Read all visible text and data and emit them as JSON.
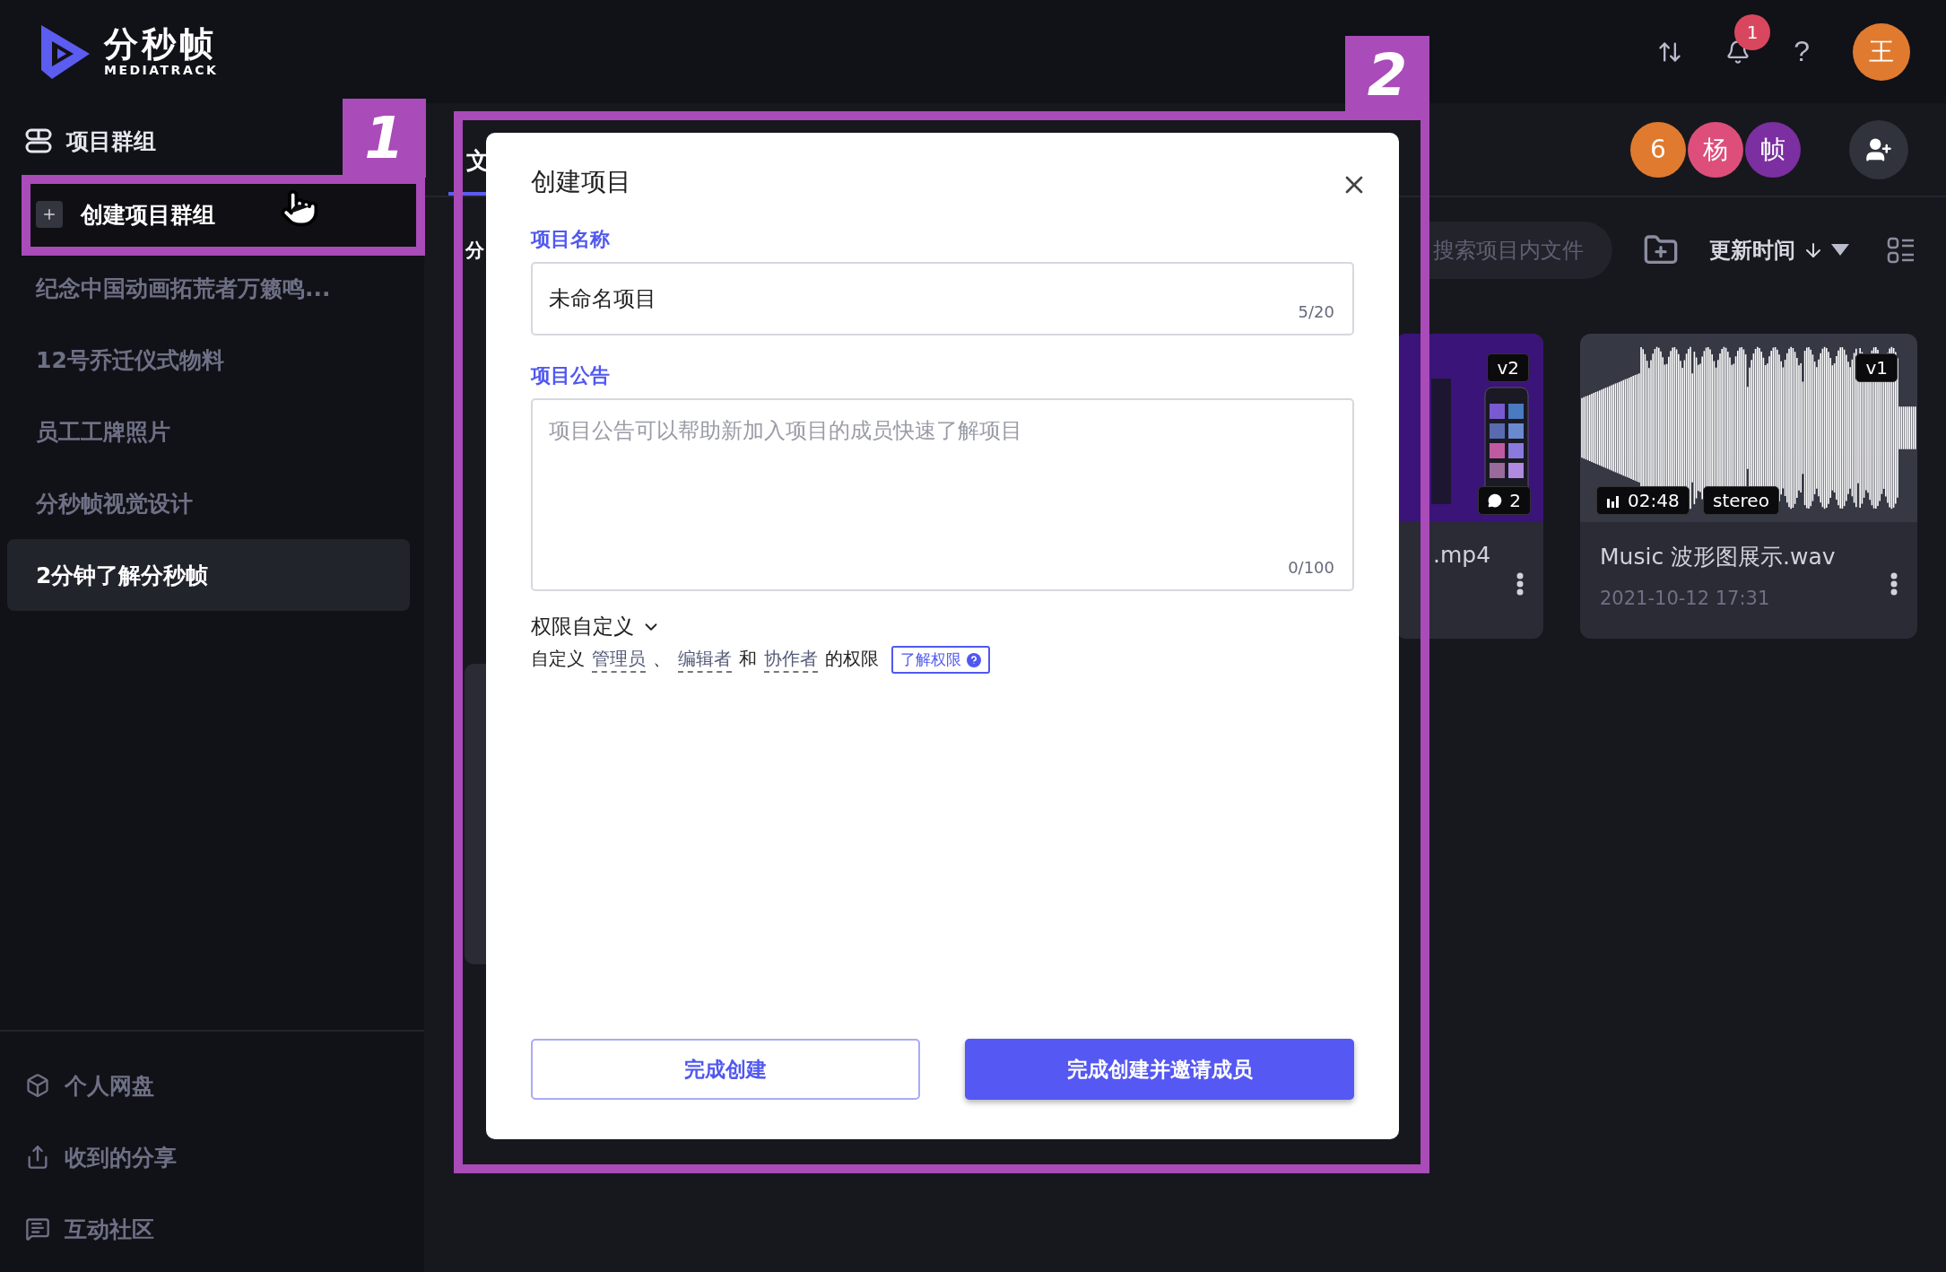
{
  "logo": {
    "name": "分秒帧",
    "subtitle": "MEDIATRACK"
  },
  "header_actions": {
    "notification_count": "1",
    "help": "?",
    "user_avatar": "王"
  },
  "sidebar": {
    "section_title": "项目群组",
    "create_button": "创建项目群组",
    "groups": [
      {
        "label": "纪念中国动画拓荒者万籁鸣...",
        "selected": false
      },
      {
        "label": "12号乔迁仪式物料",
        "selected": false
      },
      {
        "label": "员工工牌照片",
        "selected": false
      },
      {
        "label": "分秒帧视觉设计",
        "selected": false
      },
      {
        "label": "2分钟了解分秒帧",
        "selected": true
      }
    ],
    "bottom_links": [
      {
        "label": "个人网盘",
        "kind": "drive"
      },
      {
        "label": "收到的分享",
        "kind": "share"
      },
      {
        "label": "互动社区",
        "kind": "community"
      }
    ]
  },
  "project": {
    "tab": {
      "label": "文",
      "selected": true
    },
    "breadcrumb": "分",
    "members": [
      {
        "label": "6",
        "color": "#e07a2f"
      },
      {
        "label": "杨",
        "color": "#dd4f7a"
      },
      {
        "label": "帧",
        "color": "#7b2fa0"
      }
    ],
    "search": {
      "placeholder": "搜索项目内文件"
    },
    "sort": {
      "label": "更新时间"
    }
  },
  "files": [
    {
      "kind": "video",
      "title": ".mp4",
      "version": "v2",
      "comments": "2"
    },
    {
      "kind": "audio",
      "title": "Music 波形图展示.wav",
      "version": "v1",
      "duration": "02:48",
      "channels": "stereo",
      "date": "2021-10-12 17:31"
    }
  ],
  "dialog": {
    "title": "创建项目",
    "name_label": "项目名称",
    "name_value": "未命名项目",
    "name_counter": "5/20",
    "notice_label": "项目公告",
    "notice_placeholder": "项目公告可以帮助新加入项目的成员快速了解项目",
    "notice_counter": "0/100",
    "permission_title": "权限自定义",
    "permission_note": [
      {
        "text": "自定义",
        "kind": "plain"
      },
      {
        "text": "管理员",
        "kind": "term"
      },
      {
        "text": "、",
        "kind": "plain"
      },
      {
        "text": "编辑者",
        "kind": "term"
      },
      {
        "text": "和",
        "kind": "plain"
      },
      {
        "text": "协作者",
        "kind": "term"
      },
      {
        "text": "的权限",
        "kind": "plain"
      }
    ],
    "learn_button": "了解权限",
    "secondary_button": "完成创建",
    "primary_button": "完成创建并邀请成员"
  },
  "annotations": [
    {
      "label": "1"
    },
    {
      "label": "2"
    }
  ]
}
